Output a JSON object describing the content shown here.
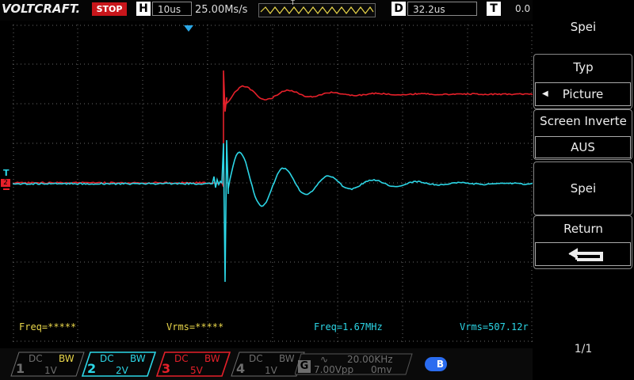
{
  "header": {
    "brand": "VOLTCRAFT.",
    "run_state": "STOP",
    "h_key": "H",
    "h_value": "10us",
    "sample_rate": "25.00Ms/s",
    "trig_marker": "T",
    "d_key": "D",
    "d_value": "32.2us",
    "t_key": "T",
    "t_value": "0.0"
  },
  "measurements": {
    "freq1": "Freq=*****",
    "vrms1": "Vrms=*****",
    "freq2": "Freq=1.67MHz",
    "vrms2": "Vrms=507.12r"
  },
  "menu": {
    "title": "Spei",
    "type_label": "Typ",
    "type_value": "Picture",
    "screen_invert_label": "Screen Inverte",
    "screen_invert_value": "AUS",
    "save_label": "Spei",
    "return_label": "Return",
    "page": "1/1"
  },
  "channels": [
    {
      "num": "1",
      "coupling": "DC",
      "bw": "BW",
      "scale": "1V",
      "color": "#6e6e6e",
      "active": false
    },
    {
      "num": "2",
      "coupling": "DC",
      "bw": "BW",
      "scale": "2V",
      "color": "#2cd6e6",
      "active": true
    },
    {
      "num": "3",
      "coupling": "DC",
      "bw": "BW",
      "scale": "5V",
      "color": "#e6202a",
      "active": true
    },
    {
      "num": "4",
      "coupling": "DC",
      "bw": "BW",
      "scale": "1V",
      "color": "#6e6e6e",
      "active": false
    }
  ],
  "generator": {
    "key": "G",
    "frequency": "20.00KHz",
    "amplitude": "7.00Vpp",
    "offset": "0mv"
  },
  "bluetooth_label": "B",
  "colors": {
    "ch2": "#2cd6e6",
    "ch3": "#e6202a",
    "grid": "#6a6a6a",
    "stop": "#c8161b",
    "meas_yellow": "#e9d64a"
  }
}
